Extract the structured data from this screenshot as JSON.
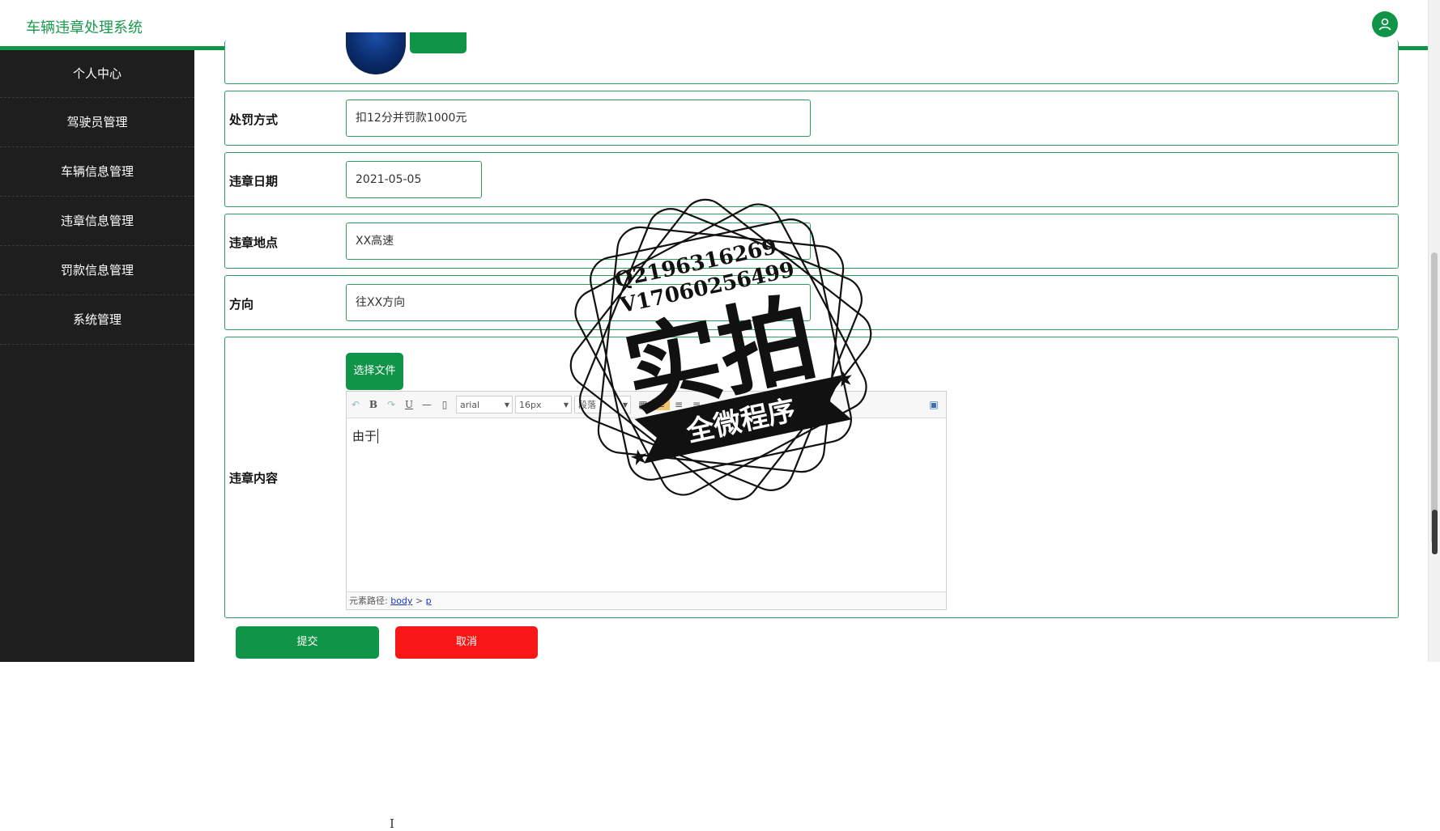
{
  "header": {
    "title": "车辆违章处理系统",
    "avatar_icon": "user-icon"
  },
  "sidebar": {
    "items": [
      {
        "label": "个人中心"
      },
      {
        "label": "驾驶员管理"
      },
      {
        "label": "车辆信息管理"
      },
      {
        "label": "违章信息管理"
      },
      {
        "label": "罚款信息管理"
      },
      {
        "label": "系统管理"
      }
    ]
  },
  "form": {
    "penalty": {
      "label": "处罚方式",
      "value": "扣12分并罚款1000元"
    },
    "date": {
      "label": "违章日期",
      "value": "2021-05-05"
    },
    "location": {
      "label": "违章地点",
      "value": "XX高速"
    },
    "direction": {
      "label": "方向",
      "value": "往XX方向"
    },
    "content": {
      "label": "违章内容",
      "choose_file": "选择文件",
      "toolbar": {
        "font": "arial",
        "size": "16px",
        "paragraph": "段落"
      },
      "body_text": "由于",
      "footer_prefix": "元素路径:",
      "footer_body": "body",
      "footer_sep": ">",
      "footer_p": "p"
    }
  },
  "actions": {
    "submit": "提交",
    "cancel": "取消"
  },
  "watermark": {
    "line1": "Q2196316269",
    "line2": "V17060256499",
    "big": "实拍",
    "ribbon": "全微程序"
  },
  "colors": {
    "primary": "#0f9448",
    "danger": "#f81717",
    "sidebar": "#1e1e1e"
  }
}
